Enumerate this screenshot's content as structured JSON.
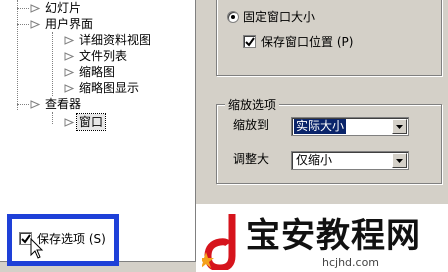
{
  "tree": {
    "items": [
      {
        "label": "幻灯片",
        "level": 1
      },
      {
        "label": "用户界面",
        "level": 1
      },
      {
        "label": "详细资料视图",
        "level": 2
      },
      {
        "label": "文件列表",
        "level": 2
      },
      {
        "label": "缩略图",
        "level": 2
      },
      {
        "label": "缩略图显示",
        "level": 2
      },
      {
        "label": "查看器",
        "level": 1
      },
      {
        "label": "窗口",
        "level": 2,
        "selected": true
      }
    ]
  },
  "window_size": {
    "fixed_size_label": "固定窗口大小",
    "fixed_size_selected": true,
    "save_position_label": "保存窗口位置 (P)",
    "save_position_checked": true
  },
  "zoom_options": {
    "group_title": "缩放选项",
    "zoom_to_label": "缩放到",
    "zoom_to_value": "实际大小",
    "adjust_label": "调整大",
    "adjust_value": "仅缩小"
  },
  "save_options": {
    "label": "保存选项 (S)",
    "checked": true
  },
  "watermark": {
    "text": "宝安教程网",
    "url": "hcjhd.com"
  },
  "colors": {
    "highlight_frame": "#1e40d8",
    "selection": "#0a246a",
    "logo_red": "#d6141c"
  }
}
